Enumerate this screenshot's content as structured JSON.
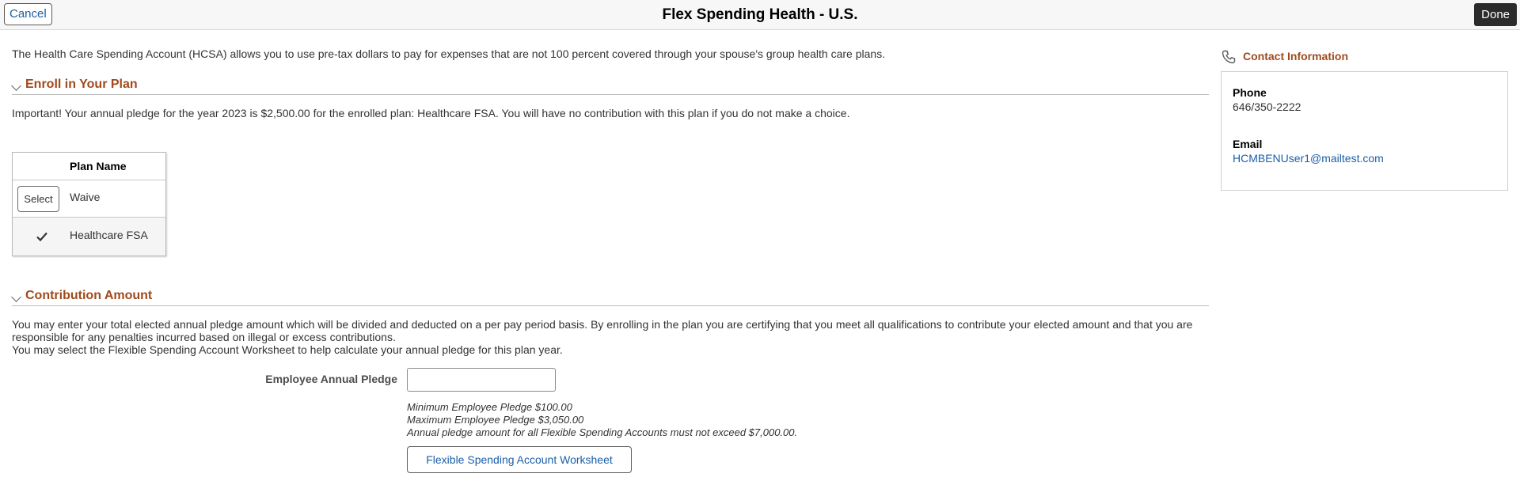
{
  "header": {
    "cancel_label": "Cancel",
    "title": "Flex Spending Health - U.S.",
    "done_label": "Done"
  },
  "intro_text": "The Health Care Spending Account (HCSA) allows you to use pre-tax dollars to pay for expenses that are not 100 percent covered through your spouse's group health care plans.",
  "enroll": {
    "section_title": "Enroll in Your Plan",
    "notice": "Important! Your annual pledge for the year 2023 is $2,500.00 for the enrolled plan: Healthcare FSA. You will have no contribution with this plan if you do not make a choice.",
    "table": {
      "column_header": "Plan Name",
      "rows": [
        {
          "action_label": "Select",
          "plan_name": "Waive",
          "selected": false
        },
        {
          "action_icon": "checkmark-icon",
          "plan_name": "Healthcare FSA",
          "selected": true
        }
      ]
    }
  },
  "contribution": {
    "section_title": "Contribution Amount",
    "paragraph_1": "You may enter your total elected annual pledge amount which will be divided and deducted on a per pay period basis. By enrolling in the plan you are certifying that you meet all qualifications to contribute your elected amount and that you are responsible for any penalties incurred based on illegal or excess contributions.",
    "paragraph_2": "You may select the Flexible Spending Account Worksheet to help calculate your annual pledge for this plan year.",
    "pledge_label": "Employee Annual Pledge",
    "pledge_value": "",
    "hints": [
      "Minimum Employee Pledge $100.00",
      "Maximum Employee Pledge $3,050.00",
      "Annual pledge amount for all Flexible Spending Accounts must not exceed $7,000.00."
    ],
    "worksheet_button": "Flexible Spending Account Worksheet"
  },
  "contact": {
    "title": "Contact Information",
    "icon": "phone-icon",
    "phone_label": "Phone",
    "phone_value": "646/350-2222",
    "email_label": "Email",
    "email_value": "HCMBENUser1@mailtest.com"
  },
  "colors": {
    "section_title": "#a04a1c",
    "link": "#1a5fa8",
    "done_button_bg": "#2b2b2b"
  }
}
